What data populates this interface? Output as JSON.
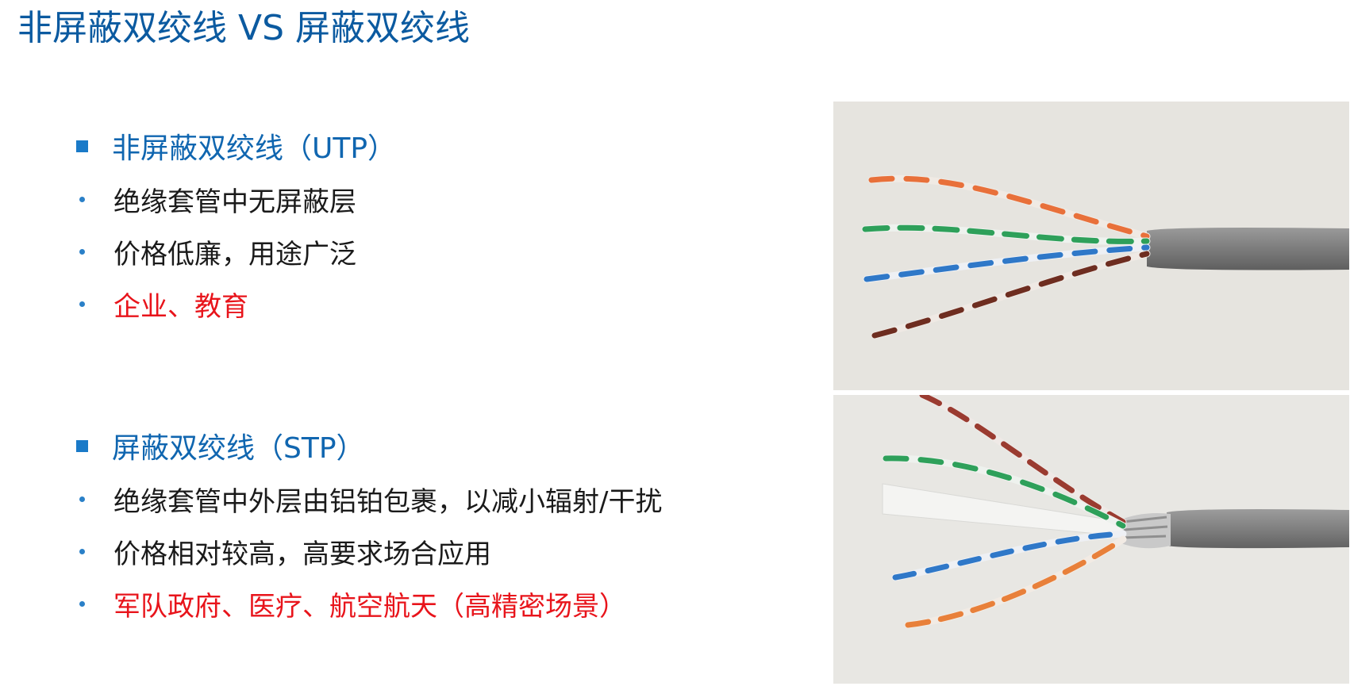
{
  "page": {
    "title": "非屏蔽双绞线 VS 屏蔽双绞线"
  },
  "utp": {
    "heading": "非屏蔽双绞线（UTP）",
    "bullets": [
      {
        "text": "绝缘套管中无屏蔽层"
      },
      {
        "text": "价格低廉，用途广泛"
      },
      {
        "text": "企业、教育"
      }
    ]
  },
  "stp": {
    "heading": "屏蔽双绞线（STP）",
    "bullets": [
      {
        "text": "绝缘套管中外层由铝铂包裹，以减小辐射/干扰"
      },
      {
        "text": "价格相对较高，高要求场合应用"
      },
      {
        "text": "军队政府、医疗、航空航天（高精密场景）"
      }
    ]
  },
  "colors": {
    "title": "#0b5aa0",
    "heading": "#1066b0",
    "bullet_text": "#1a1a1a",
    "emphasis_red": "#e8141b",
    "square_marker": "#1a7ac8",
    "dot_marker": "#2a80c8"
  }
}
